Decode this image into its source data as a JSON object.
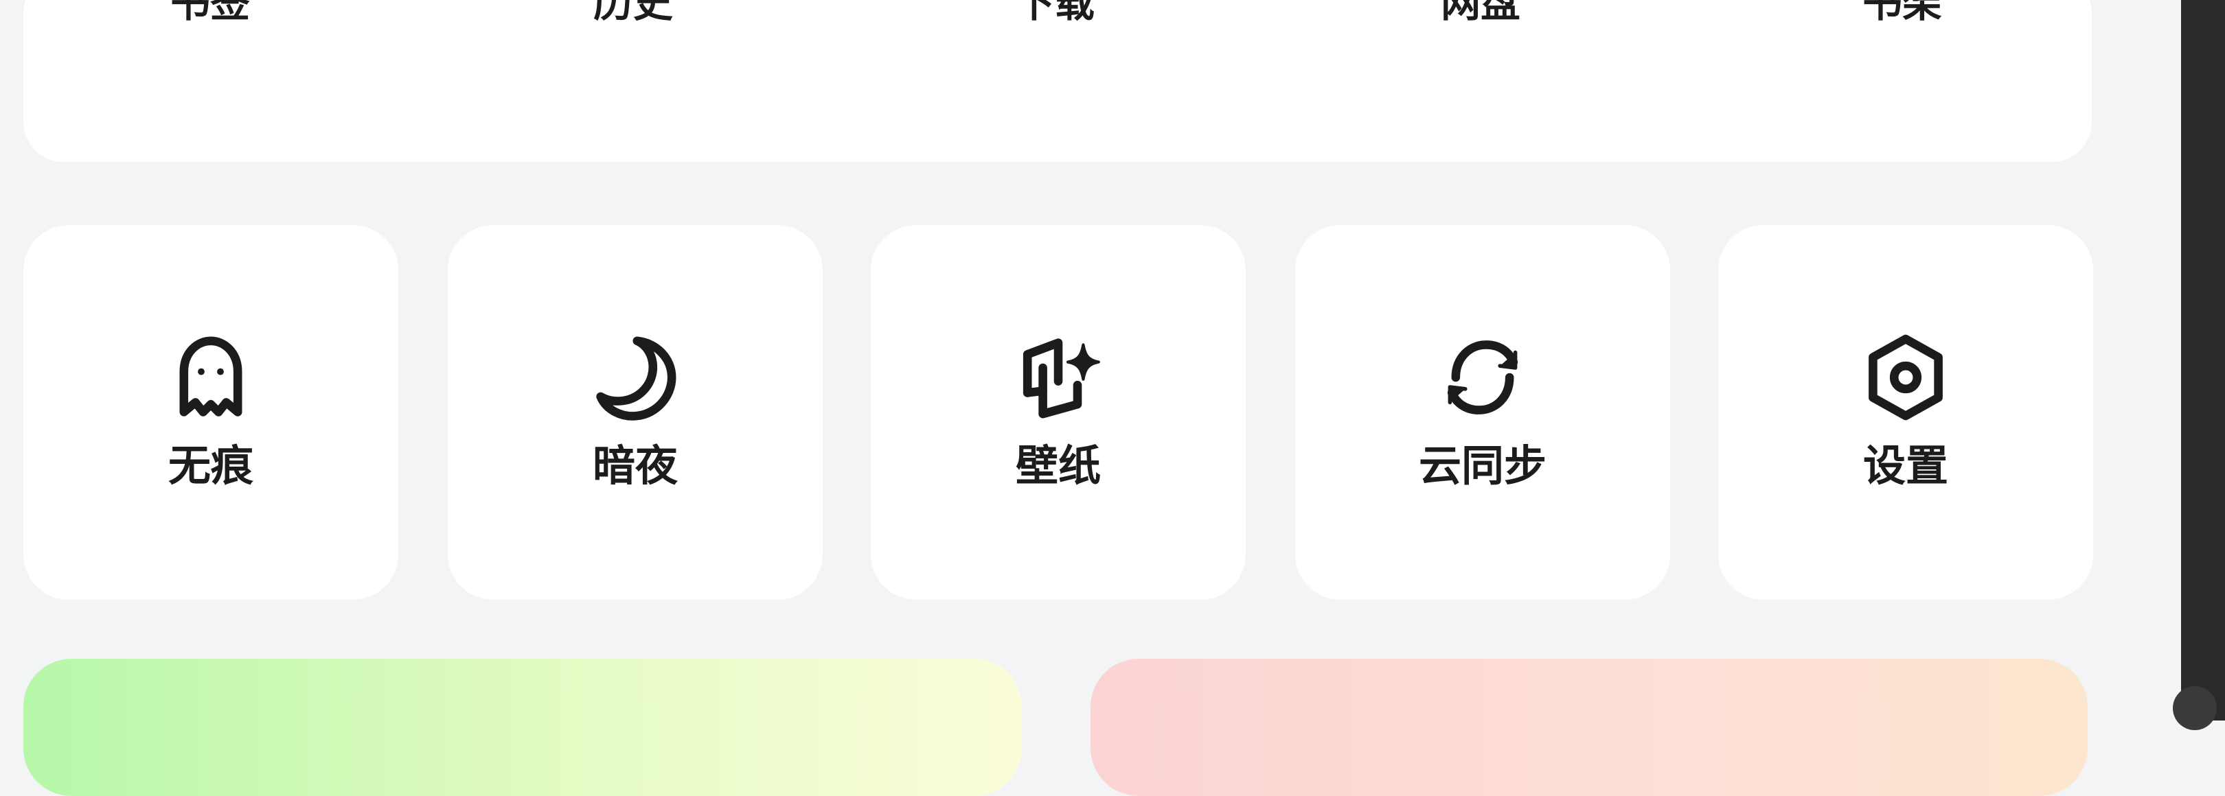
{
  "top_menu": {
    "items": [
      {
        "label": "书签"
      },
      {
        "label": "历史"
      },
      {
        "label": "下载"
      },
      {
        "label": "网盘"
      },
      {
        "label": "书架"
      }
    ]
  },
  "quick_actions": [
    {
      "label": "无痕",
      "icon": "ghost-icon"
    },
    {
      "label": "暗夜",
      "icon": "moon-icon"
    },
    {
      "label": "壁纸",
      "icon": "wallpaper-icon"
    },
    {
      "label": "云同步",
      "icon": "sync-icon"
    },
    {
      "label": "设置",
      "icon": "settings-hexagon-icon"
    }
  ],
  "colors": {
    "background": "#f3f4f6",
    "card": "#ffffff",
    "text": "#1c1c1e",
    "banner_left_start": "#b6f7a9",
    "banner_left_end": "#fbfdd9",
    "banner_right_start": "#fbd3d3",
    "banner_right_end": "#fde6cf"
  }
}
